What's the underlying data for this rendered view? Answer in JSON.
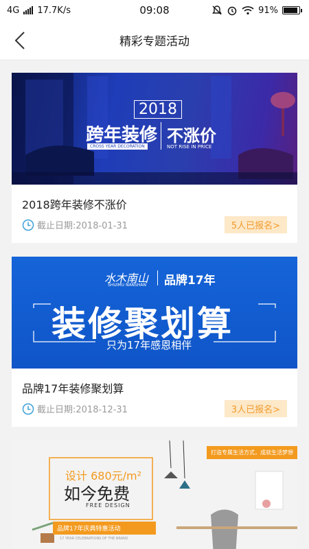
{
  "status_bar": {
    "network": "4G",
    "speed": "17.7K/s",
    "time": "09:08",
    "battery": "91%",
    "battery_level": 0.91
  },
  "header": {
    "title": "精彩专题活动"
  },
  "cards": [
    {
      "title": "2018跨年装修不涨价",
      "deadline": "截止日期:2018-01-31",
      "signup": "5人已报名>",
      "banner": {
        "year": "2018",
        "headline_left": "跨年装修",
        "headline_right": "不涨价",
        "sub_left": "CROSS YEAR DECORATION",
        "sub_right": "NOT RISE IN PRICE"
      }
    },
    {
      "title": "品牌17年装修聚划算",
      "deadline": "截止日期:2018-12-31",
      "signup": "3人已报名>",
      "banner": {
        "logo": "水木南山",
        "logo_en": "SHUIMU NANSHAN",
        "brand_years": "品牌17年",
        "headline": "装修聚划算",
        "subline": "只为17年感恩相伴"
      }
    },
    {
      "banner": {
        "tagline": "打造专属生活方式，成就生活梦想",
        "design_price": "设计 680元/m²",
        "free": "如今免费",
        "free_en": "FREE DESIGN",
        "promo": "品牌17年庆典特惠活动",
        "promo_en": "17 YEAR CELEBRATIONS OF THE BRAND"
      }
    }
  ],
  "colors": {
    "badge_bg": "#fde8c8",
    "badge_text": "#f29b2b",
    "clock_icon": "#3aa0d9",
    "orange": "#f39a1e"
  }
}
